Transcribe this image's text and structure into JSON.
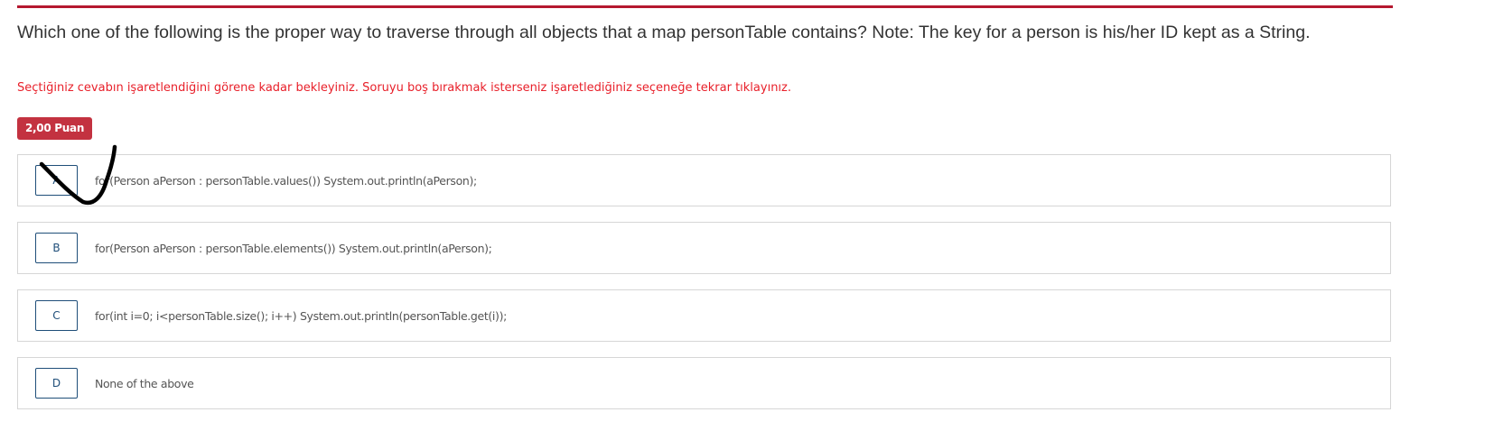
{
  "question": {
    "text": "Which one of the following is the proper way to traverse through all objects that a map personTable contains? Note: The key for a person is his/her ID kept as a String."
  },
  "warning": "Seçtiğiniz cevabın işaretlendiğini görene kadar bekleyiniz. Soruyu boş bırakmak isterseniz işaretlediğiniz seçeneğe tekrar tıklayınız.",
  "points_badge": "2,00 Puan",
  "options": [
    {
      "letter": "A",
      "text": "for(Person aPerson : personTable.values()) System.out.println(aPerson);"
    },
    {
      "letter": "B",
      "text": "for(Person aPerson : personTable.elements()) System.out.println(aPerson);"
    },
    {
      "letter": "C",
      "text": "for(int i=0; i<personTable.size(); i++) System.out.println(personTable.get(i));"
    },
    {
      "letter": "D",
      "text": "None of the above"
    }
  ],
  "colors": {
    "accent_rule": "#b5182f",
    "warning_text": "#e8202a",
    "badge_bg": "#c33240",
    "letter_box_border": "#1f4e79",
    "handwritten_mark": "#000000"
  },
  "annotations": {
    "handwritten_checkmark_on": "A"
  }
}
